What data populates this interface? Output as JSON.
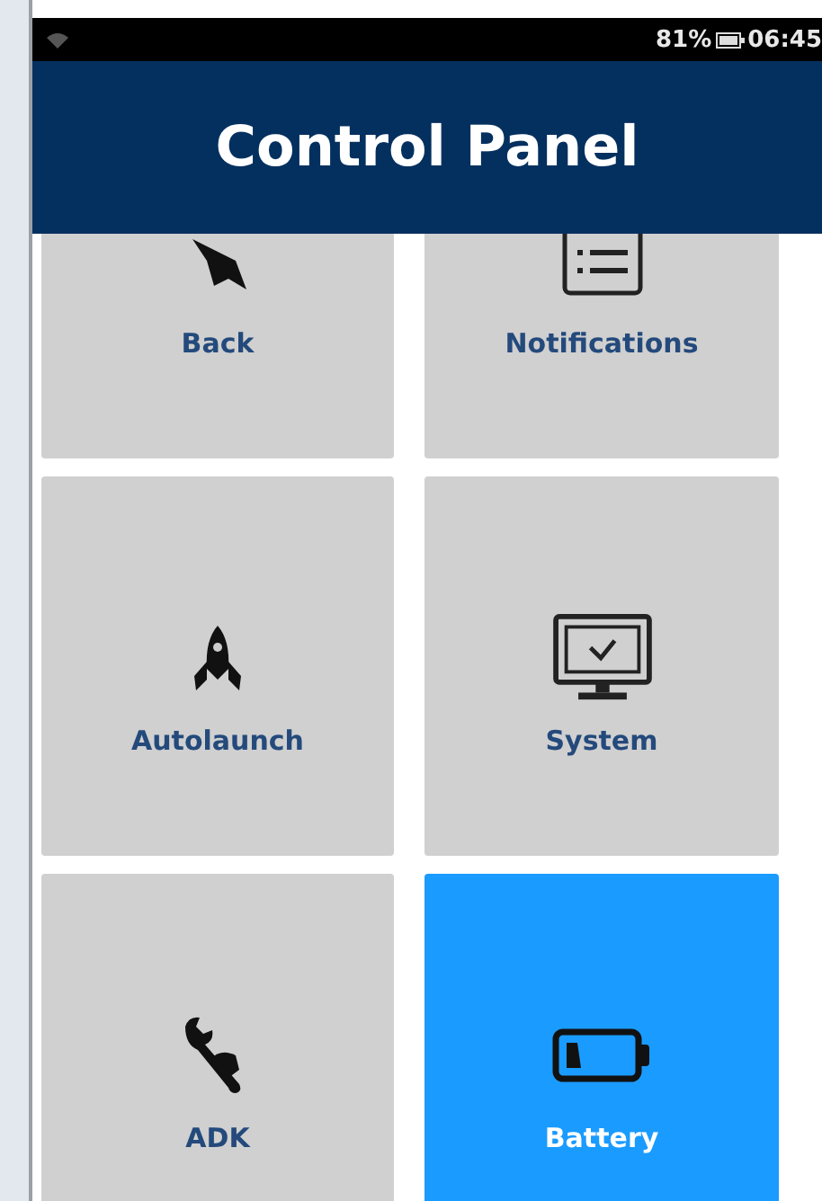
{
  "status_bar": {
    "battery": "81%",
    "time": "06:45"
  },
  "header": {
    "title": "Control Panel"
  },
  "tiles": [
    {
      "label": "Back",
      "selected": false
    },
    {
      "label": "Notifications",
      "selected": false
    },
    {
      "label": "Autolaunch",
      "selected": false
    },
    {
      "label": "System",
      "selected": false
    },
    {
      "label": "ADK",
      "selected": false
    },
    {
      "label": "Battery",
      "selected": true
    }
  ]
}
